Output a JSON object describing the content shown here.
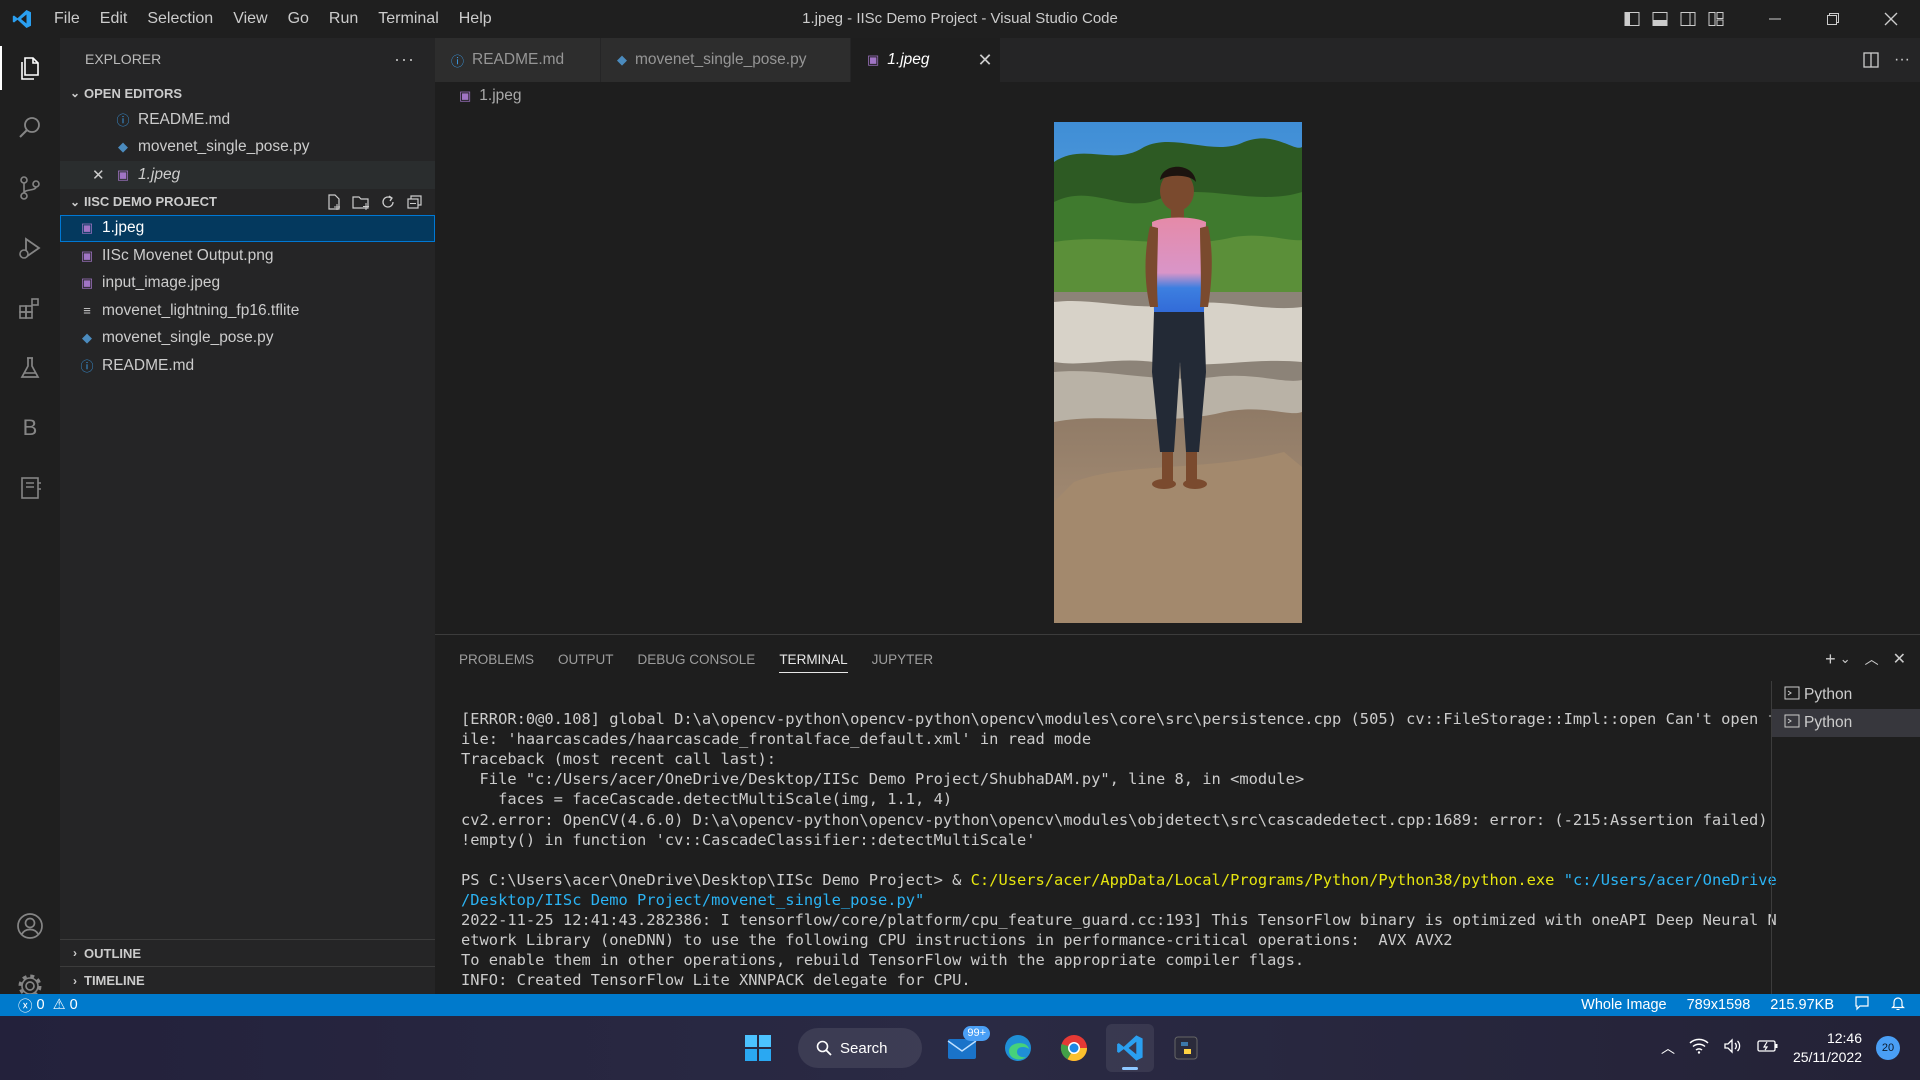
{
  "window": {
    "title": "1.jpeg - IISc Demo Project - Visual Studio Code"
  },
  "menu": [
    "File",
    "Edit",
    "Selection",
    "View",
    "Go",
    "Run",
    "Terminal",
    "Help"
  ],
  "activity": {
    "extensions_letter": "B"
  },
  "sidebar": {
    "title": "EXPLORER",
    "more_label": "···",
    "open_editors": {
      "label": "OPEN EDITORS",
      "items": [
        {
          "name": "README.md",
          "icon": "info-icon"
        },
        {
          "name": "movenet_single_pose.py",
          "icon": "python-icon"
        },
        {
          "name": "1.jpeg",
          "icon": "image-icon"
        }
      ]
    },
    "project": {
      "label": "IISC DEMO PROJECT",
      "files": [
        {
          "name": "1.jpeg",
          "icon": "image-icon"
        },
        {
          "name": "IISc Movenet Output.png",
          "icon": "image-icon"
        },
        {
          "name": "input_image.jpeg",
          "icon": "image-icon"
        },
        {
          "name": "movenet_lightning_fp16.tflite",
          "icon": "file-lines-icon"
        },
        {
          "name": "movenet_single_pose.py",
          "icon": "python-icon"
        },
        {
          "name": "README.md",
          "icon": "info-icon"
        }
      ]
    },
    "outline_label": "OUTLINE",
    "timeline_label": "TIMELINE"
  },
  "editor": {
    "tabs": [
      {
        "label": "README.md",
        "icon": "info-icon"
      },
      {
        "label": "movenet_single_pose.py",
        "icon": "python-icon"
      },
      {
        "label": "1.jpeg",
        "icon": "image-icon"
      }
    ],
    "breadcrumb": "1.jpeg"
  },
  "panel": {
    "tabs": [
      "PROBLEMS",
      "OUTPUT",
      "DEBUG CONSOLE",
      "TERMINAL",
      "JUPYTER"
    ],
    "terminal_lines": [
      "[ERROR:0@0.108] global D:\\a\\opencv-python\\opencv-python\\opencv\\modules\\core\\src\\persistence.cpp (505) cv::FileStorage::Impl::open Can't open f",
      "ile: 'haarcascades/haarcascade_frontalface_default.xml' in read mode",
      "Traceback (most recent call last):",
      "  File \"c:/Users/acer/OneDrive/Desktop/IISc Demo Project/ShubhaDAM.py\", line 8, in <module>",
      "    faces = faceCascade.detectMultiScale(img, 1.1, 4)",
      "cv2.error: OpenCV(4.6.0) D:\\a\\opencv-python\\opencv-python\\opencv\\modules\\objdetect\\src\\cascadedetect.cpp:1689: error: (-215:Assertion failed)",
      "!empty() in function 'cv::CascadeClassifier::detectMultiScale'",
      ""
    ],
    "prompt": "PS C:\\Users\\acer\\OneDrive\\Desktop\\IISc Demo Project> & ",
    "exe_path": "C:/Users/acer/AppData/Local/Programs/Python/Python38/python.exe",
    "script_arg_1": "\"c:/Users/acer/OneDrive",
    "script_arg_2": "/Desktop/IISc Demo Project/movenet_single_pose.py\"",
    "output_lines": [
      "2022-11-25 12:41:43.282386: I tensorflow/core/platform/cpu_feature_guard.cc:193] This TensorFlow binary is optimized with oneAPI Deep Neural N",
      "etwork Library (oneDNN) to use the following CPU instructions in performance-critical operations:  AVX AVX2",
      "To enable them in other operations, rebuild TensorFlow with the appropriate compiler flags.",
      "INFO: Created TensorFlow Lite XNNPACK delegate for CPU."
    ],
    "terminals": [
      "Python",
      "Python"
    ]
  },
  "status": {
    "errors": "0",
    "warnings": "0",
    "zoom": "Whole Image",
    "dimensions": "789x1598",
    "size": "215.97KB"
  },
  "taskbar": {
    "search_label": "Search",
    "mail_badge": "99+",
    "time": "12:46",
    "date": "25/11/2022",
    "notifications": "20"
  }
}
